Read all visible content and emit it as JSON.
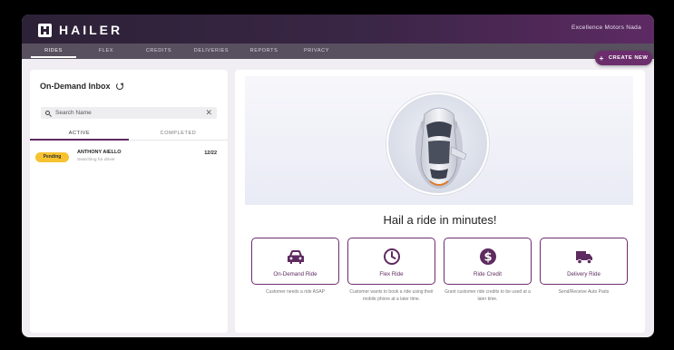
{
  "header": {
    "logo_text": "HAILER",
    "account_name": "Excellence Motors Nada"
  },
  "nav": {
    "tabs": [
      {
        "label": "RIDES",
        "active": true
      },
      {
        "label": "FLEX",
        "active": false
      },
      {
        "label": "CREDITS",
        "active": false
      },
      {
        "label": "DELIVERIES",
        "active": false
      },
      {
        "label": "REPORTS",
        "active": false
      },
      {
        "label": "PRIVACY",
        "active": false
      }
    ],
    "create_label": "CREATE NEW"
  },
  "inbox": {
    "title": "On-Demand Inbox",
    "search_placeholder": "Search Name",
    "tabs": [
      {
        "label": "ACTIVE",
        "active": true
      },
      {
        "label": "COMPLETED",
        "active": false
      }
    ],
    "rides": [
      {
        "status_badge": "Pending",
        "name": "ANTHONY AIELLO",
        "status_text": "Searching for driver",
        "date": "12/22"
      }
    ]
  },
  "main": {
    "hero_title": "Hail a ride in minutes!",
    "options": [
      {
        "label": "On-Demand Ride",
        "description": "Customer needs a ride ASAP",
        "icon": "car-icon"
      },
      {
        "label": "Flex Ride",
        "description": "Customer wants to book a ride using their mobile phone at a later time.",
        "icon": "clock-icon"
      },
      {
        "label": "Ride Credit",
        "description": "Grant customer ride credits to be used at a later time.",
        "icon": "dollar-icon"
      },
      {
        "label": "Delivery Ride",
        "description": "Send/Receive Auto Parts",
        "icon": "truck-icon"
      }
    ]
  },
  "colors": {
    "brand": "#5e2b60",
    "pending": "#f6c230",
    "nav_bg": "#59505f"
  }
}
